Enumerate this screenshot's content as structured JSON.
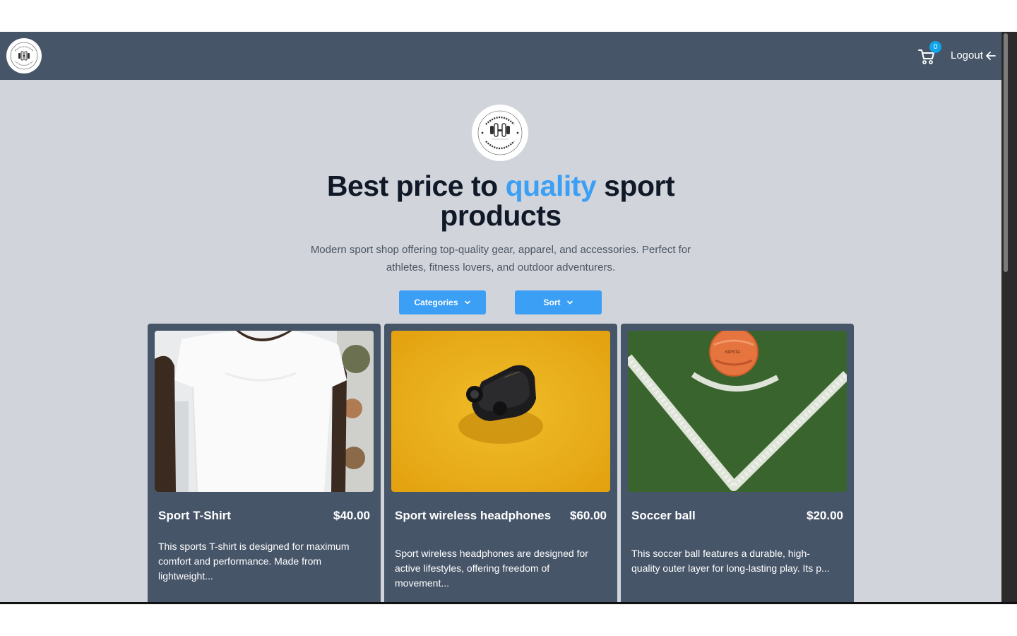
{
  "header": {
    "cart_count": "0",
    "logout_label": "Logout"
  },
  "hero": {
    "title_before": "Best price to ",
    "title_accent": "quality",
    "title_after": " sport products",
    "description": "Modern sport shop offering top-quality gear, apparel, and accessories. Perfect for athletes, fitness lovers, and outdoor adventurers."
  },
  "filters": {
    "categories_label": "Categories",
    "sort_label": "Sort"
  },
  "products": [
    {
      "name": "Sport T-Shirt",
      "price": "$40.00",
      "description": "This sports T-shirt is designed for maximum comfort and performance. Made from lightweight..."
    },
    {
      "name": "Sport wireless headphones",
      "price": "$60.00",
      "description": "Sport wireless headphones are designed for active lifestyles, offering freedom of movement..."
    },
    {
      "name": "Soccer ball",
      "price": "$20.00",
      "description": "This soccer ball features a durable, high-quality outer layer for long-lasting play. Its p..."
    }
  ],
  "colors": {
    "header_bg": "#475569",
    "page_bg": "#d1d5db",
    "accent": "#3b9ff5",
    "badge": "#0ea5e9"
  },
  "icons": [
    "shop-logo-icon",
    "cart-icon",
    "arrow-left-icon",
    "chevron-down-icon"
  ]
}
